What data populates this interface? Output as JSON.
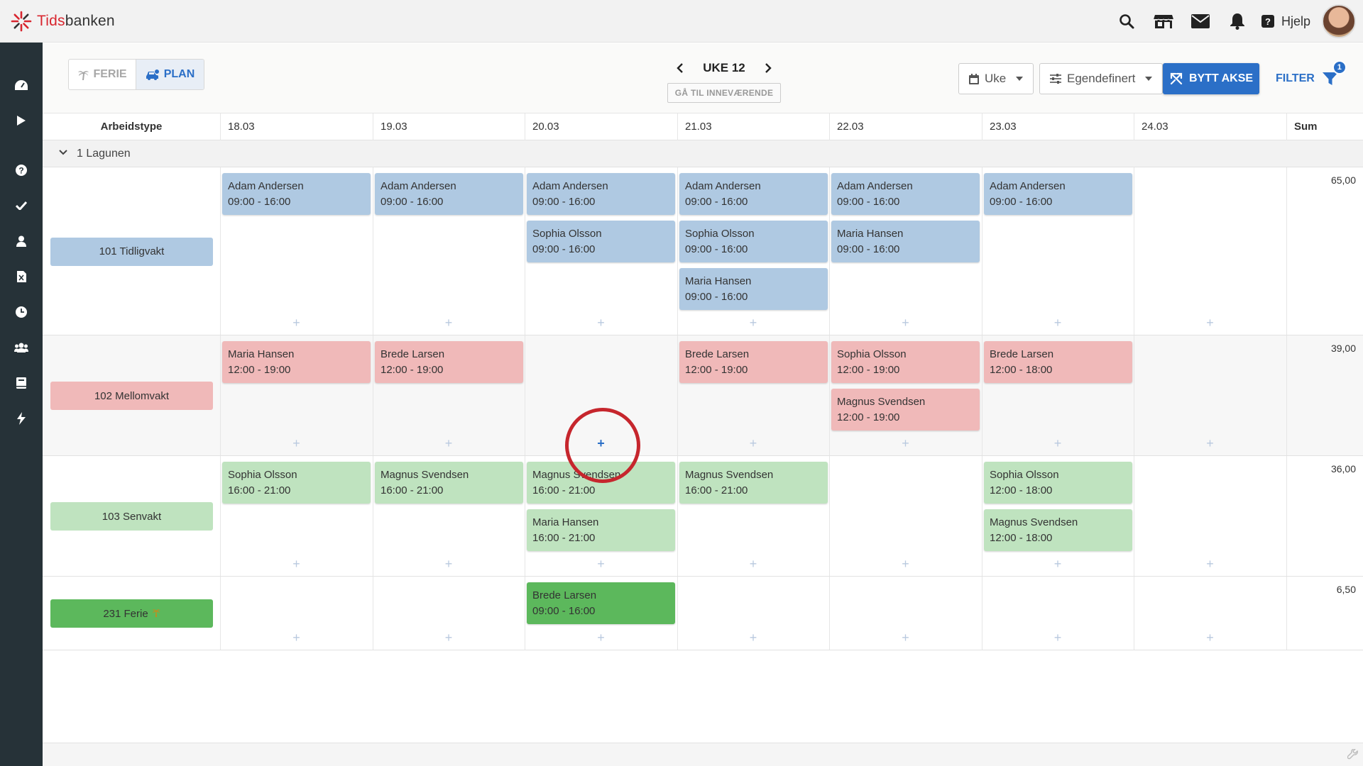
{
  "app": {
    "brand_red": "Tids",
    "brand_rest": "banken"
  },
  "topbar": {
    "help_label": "Hjelp",
    "help_glyph": "?"
  },
  "toolbar": {
    "ferie_label": "FERIE",
    "plan_label": "PLAN",
    "week_label": "UKE 12",
    "goto_label": "GÅ TIL INNEVÆRENDE",
    "view_select": "Uke",
    "custom_select": "Egendefinert",
    "swap_axis_label": "BYTT AKSE",
    "filter_label": "FILTER",
    "filter_count": "1"
  },
  "grid": {
    "headers": [
      "Arbeidstype",
      "18.03",
      "19.03",
      "20.03",
      "21.03",
      "22.03",
      "23.03",
      "24.03",
      "Sum"
    ],
    "group": "1 Lagunen",
    "rows": [
      {
        "type": "101 Tidligvakt",
        "sum": "65,00",
        "color": "#afc9e2"
      },
      {
        "type": "102 Mellomvakt",
        "sum": "39,00",
        "color": "#f0b9b9"
      },
      {
        "type": "103 Senvakt",
        "sum": "36,00",
        "color": "#bfe3bf"
      },
      {
        "type": "231 Ferie",
        "type_icon": "palm-tree-icon",
        "sum": "6,50",
        "color": "#5cb85c"
      }
    ],
    "shifts": [
      {
        "row": 0,
        "day": 0,
        "slot": 0,
        "name": "Adam Andersen",
        "time": "09:00 - 16:00"
      },
      {
        "row": 0,
        "day": 1,
        "slot": 0,
        "name": "Adam Andersen",
        "time": "09:00 - 16:00"
      },
      {
        "row": 0,
        "day": 2,
        "slot": 0,
        "name": "Adam Andersen",
        "time": "09:00 - 16:00"
      },
      {
        "row": 0,
        "day": 2,
        "slot": 1,
        "name": "Sophia Olsson",
        "time": "09:00 - 16:00"
      },
      {
        "row": 0,
        "day": 3,
        "slot": 0,
        "name": "Adam Andersen",
        "time": "09:00 - 16:00"
      },
      {
        "row": 0,
        "day": 3,
        "slot": 1,
        "name": "Sophia Olsson",
        "time": "09:00 - 16:00"
      },
      {
        "row": 0,
        "day": 3,
        "slot": 2,
        "name": "Maria Hansen",
        "time": "09:00 - 16:00"
      },
      {
        "row": 0,
        "day": 4,
        "slot": 0,
        "name": "Adam Andersen",
        "time": "09:00 - 16:00"
      },
      {
        "row": 0,
        "day": 4,
        "slot": 1,
        "name": "Maria Hansen",
        "time": "09:00 - 16:00"
      },
      {
        "row": 0,
        "day": 5,
        "slot": 0,
        "name": "Adam Andersen",
        "time": "09:00 - 16:00"
      },
      {
        "row": 1,
        "day": 0,
        "slot": 0,
        "name": "Maria Hansen",
        "time": "12:00 - 19:00"
      },
      {
        "row": 1,
        "day": 1,
        "slot": 0,
        "name": "Brede Larsen",
        "time": "12:00 - 19:00"
      },
      {
        "row": 1,
        "day": 3,
        "slot": 0,
        "name": "Brede Larsen",
        "time": "12:00 - 19:00"
      },
      {
        "row": 1,
        "day": 4,
        "slot": 0,
        "name": "Sophia Olsson",
        "time": "12:00 - 19:00"
      },
      {
        "row": 1,
        "day": 4,
        "slot": 1,
        "name": "Magnus Svendsen",
        "time": "12:00 - 19:00"
      },
      {
        "row": 1,
        "day": 5,
        "slot": 0,
        "name": "Brede Larsen",
        "time": "12:00 - 18:00"
      },
      {
        "row": 2,
        "day": 0,
        "slot": 0,
        "name": "Sophia Olsson",
        "time": "16:00 - 21:00"
      },
      {
        "row": 2,
        "day": 1,
        "slot": 0,
        "name": "Magnus Svendsen",
        "time": "16:00 - 21:00"
      },
      {
        "row": 2,
        "day": 2,
        "slot": 0,
        "name": "Magnus Svendsen",
        "time": "16:00 - 21:00"
      },
      {
        "row": 2,
        "day": 2,
        "slot": 1,
        "name": "Maria Hansen",
        "time": "16:00 - 21:00"
      },
      {
        "row": 2,
        "day": 3,
        "slot": 0,
        "name": "Magnus Svendsen",
        "time": "16:00 - 21:00"
      },
      {
        "row": 2,
        "day": 5,
        "slot": 0,
        "name": "Sophia Olsson",
        "time": "12:00 - 18:00"
      },
      {
        "row": 2,
        "day": 5,
        "slot": 1,
        "name": "Magnus Svendsen",
        "time": "12:00 - 18:00"
      },
      {
        "row": 3,
        "day": 2,
        "slot": 0,
        "name": "Brede Larsen",
        "time": "09:00 - 16:00"
      }
    ],
    "active_add": {
      "row": 1,
      "day": 2
    }
  }
}
